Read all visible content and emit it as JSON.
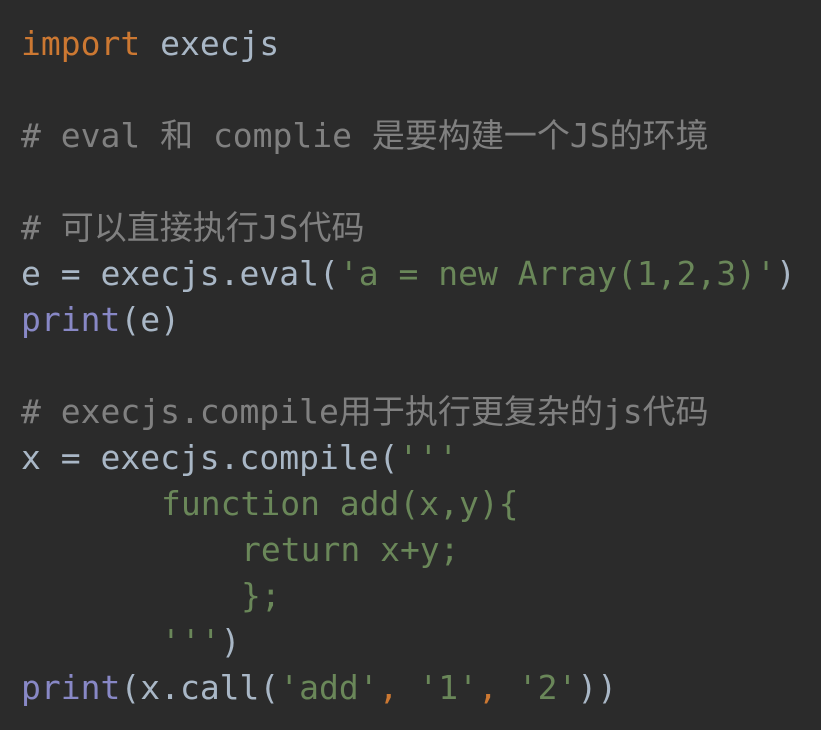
{
  "lines": {
    "l1": {
      "kw": "import",
      "rest": " execjs"
    },
    "l3": {
      "comment": "# eval 和 complie 是要构建一个JS的环境"
    },
    "l5": {
      "comment": "# 可以直接执行JS代码"
    },
    "l6": {
      "pre": "e = execjs.eval(",
      "str": "'a = new Array(1,2,3)'",
      "post": ")"
    },
    "l7": {
      "builtin": "print",
      "rest": "(e)"
    },
    "l9": {
      "comment": "# execjs.compile用于执行更复杂的js代码"
    },
    "l10": {
      "pre": "x = execjs.compile(",
      "str": "'''"
    },
    "l11": {
      "str": "function add(x,y){"
    },
    "l12": {
      "str": "return x+y;"
    },
    "l13": {
      "str": "};"
    },
    "l14": {
      "str": "'''",
      "post": ")"
    },
    "l15": {
      "builtin": "print",
      "pre": "(x.call(",
      "s1": "'add'",
      "c1": ", ",
      "s2": "'1'",
      "c2": ", ",
      "s3": "'2'",
      "post": "))"
    }
  }
}
